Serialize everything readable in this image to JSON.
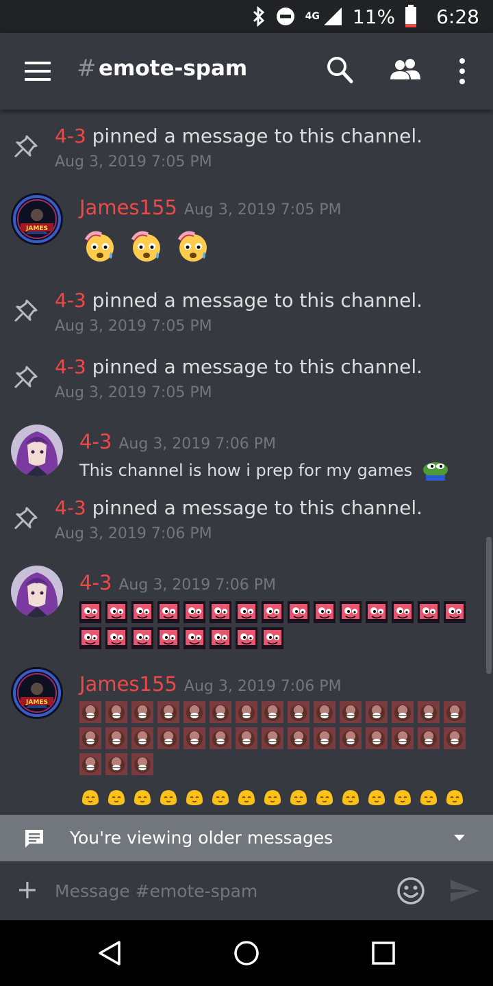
{
  "status_bar": {
    "network": "4G",
    "battery": "11%",
    "time": "6:28"
  },
  "header": {
    "hash": "#",
    "channel": "emote-spam"
  },
  "feed": {
    "pin_text": "pinned a message to this channel.",
    "pins": [
      {
        "author": "4-3",
        "time": "Aug 3, 2019 7:05 PM"
      },
      {
        "author": "4-3",
        "time": "Aug 3, 2019 7:05 PM"
      },
      {
        "author": "4-3",
        "time": "Aug 3, 2019 7:05 PM"
      },
      {
        "author": "4-3",
        "time": "Aug 3, 2019 7:06 PM"
      }
    ],
    "messages": [
      {
        "author": "James155",
        "time": "Aug 3, 2019 7:05 PM",
        "avatar_text": "JAMES"
      },
      {
        "author": "4-3",
        "time": "Aug 3, 2019 7:06 PM",
        "text": "This channel is how i prep for my games"
      },
      {
        "author": "4-3",
        "time": "Aug 3, 2019 7:06 PM"
      },
      {
        "author": "James155",
        "time": "Aug 3, 2019 7:06 PM",
        "avatar_text": "JAMES"
      }
    ],
    "emote_counts": {
      "sweat": 3,
      "creeper": 23,
      "grin_photo": 33,
      "blob": 15
    }
  },
  "older_bar": {
    "text": "You're viewing older messages"
  },
  "composer": {
    "plus": "+",
    "placeholder": "Message #emote-spam"
  },
  "colors": {
    "background": "#36393f",
    "author_red": "#f04747",
    "muted": "#72767d",
    "text": "#dcddde"
  }
}
